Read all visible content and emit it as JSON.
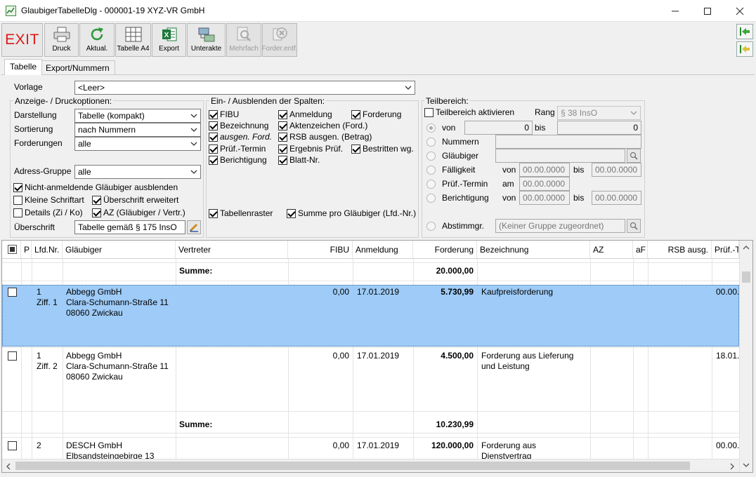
{
  "window": {
    "title": "GlaubigerTabelleDlg - 000001-19 XYZ-VR GmbH",
    "min": "—",
    "max": "☐",
    "close": "✕"
  },
  "toolbar": {
    "exit": "EXIT",
    "buttons": [
      "Druck",
      "Aktual.",
      "Tabelle A4",
      "Export",
      "Unterakte",
      "Mehrfach",
      "Forder.entf."
    ]
  },
  "tabs": [
    "Tabelle",
    "Export/Nummern"
  ],
  "form": {
    "vorlage_label": "Vorlage",
    "vorlage_value": "<Leer>",
    "anzeige_title": "Anzeige- / Druckoptionen:",
    "darstellung_label": "Darstellung",
    "darstellung_value": "Tabelle (kompakt)",
    "sortierung_label": "Sortierung",
    "sortierung_value": "nach Nummern",
    "forderungen_label": "Forderungen",
    "forderungen_value": "alle",
    "adress_label": "Adress-Gruppe",
    "adress_value": "alle",
    "cb_nicht_anmeldende": "Nicht-anmeldende Gläubiger ausblenden",
    "cb_kleine_schrift": "Kleine Schriftart",
    "cb_ueberschrift_erw": "Überschrift erweitert",
    "cb_details": "Details (Zi / Ko)",
    "cb_az": "AZ (Gläubiger / Vertr.)",
    "ueberschrift_label": "Überschrift",
    "ueberschrift_value": "Tabelle gemäß § 175 InsO"
  },
  "columns_box": {
    "title": "Ein- / Ausblenden der Spalten:",
    "items": [
      "FIBU",
      "Anmeldung",
      "Forderung",
      "Bezeichnung",
      "Aktenzeichen (Ford.)",
      "ausgen. Ford.",
      "RSB ausgen. (Betrag)",
      "Prüf.-Termin",
      "Ergebnis Prüf.",
      "Bestritten wg.",
      "Berichtigung",
      "Blatt-Nr."
    ],
    "tabellenraster": "Tabellenraster",
    "summe_pro": "Summe pro Gläubiger (Lfd.-Nr.)"
  },
  "teilbereich": {
    "title": "Teilbereich:",
    "aktivieren": "Teilbereich aktivieren",
    "rang_label": "Rang",
    "rang_value": "§ 38 InsO",
    "von": "von",
    "von_value": "0",
    "bis": "bis",
    "bis_value": "0",
    "nummern": "Nummern",
    "glaeubiger": "Gläubiger",
    "faelligkeit": "Fälligkeit",
    "fael_von": "von",
    "fael_von_value": "00.00.0000",
    "fael_bis": "bis",
    "fael_bis_value": "00.00.0000",
    "pruef_termin": "Prüf.-Termin",
    "pruef_am": "am",
    "pruef_am_value": "00.00.0000",
    "berichtigung": "Berichtigung",
    "ber_von": "von",
    "ber_von_value": "00.00.0000",
    "ber_bis": "bis",
    "ber_bis_value": "00.00.0000",
    "abstimm": "Abstimmgr.",
    "abstimm_value": "(Keiner Gruppe zugeordnet)"
  },
  "grid": {
    "headers": [
      "P",
      "Lfd.Nr.",
      "Gläubiger",
      "Vertreter",
      "FIBU",
      "Anmeldung",
      "Forderung",
      "Bezeichnung",
      "AZ",
      "aF",
      "RSB ausg.",
      "Prüf.-T"
    ],
    "summe_label": "Summe:",
    "summe_top": "20.000,00",
    "rows": [
      {
        "lfd": "1",
        "ziff": "Ziff. 1",
        "glaeubiger": [
          "Abbegg GmbH",
          "Clara-Schumann-Straße 11",
          "08060 Zwickau"
        ],
        "fibu": "0,00",
        "anmeldung": "17.01.2019",
        "forderung": "5.730,99",
        "bezeichnung": [
          "Kaufpreisforderung"
        ],
        "pruef": "00.00."
      },
      {
        "lfd": "1",
        "ziff": "Ziff. 2",
        "glaeubiger": [
          "Abbegg GmbH",
          "Clara-Schumann-Straße 11",
          "08060 Zwickau"
        ],
        "fibu": "0,00",
        "anmeldung": "17.01.2019",
        "forderung": "4.500,00",
        "bezeichnung": [
          "Forderung aus Lieferung",
          "und Leistung"
        ],
        "pruef": "18.01."
      },
      {
        "lfd": "2",
        "ziff": "",
        "glaeubiger": [
          "DESCH GmbH",
          "Elbsandsteingebirge 13"
        ],
        "fibu": "0,00",
        "anmeldung": "17.01.2019",
        "forderung": "120.000,00",
        "bezeichnung": [
          "Forderung aus",
          "Dienstvertrag"
        ],
        "pruef": "00.00."
      }
    ],
    "summe_mid": "10.230,99"
  },
  "colors": {
    "selection": "#9ecbf7",
    "exit": "#e01818",
    "excel": "#1e7a3c"
  }
}
